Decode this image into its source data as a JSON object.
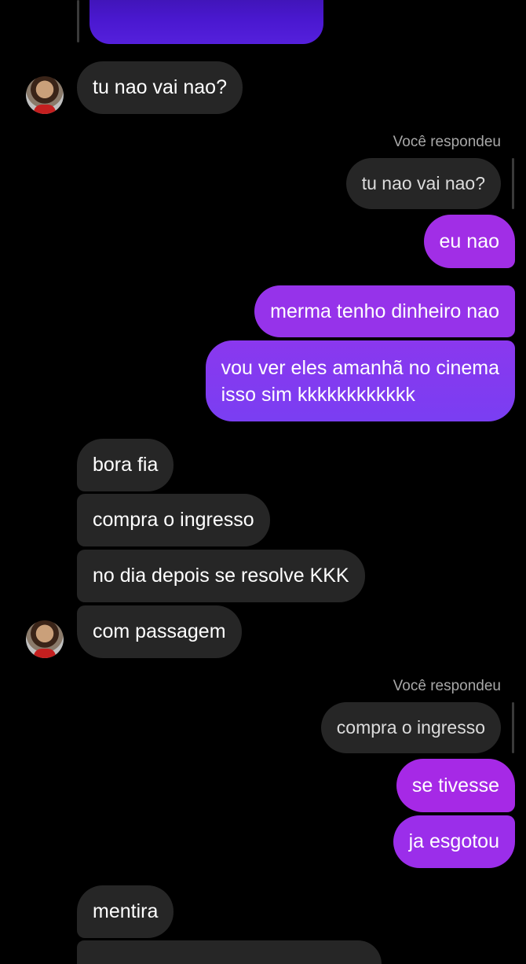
{
  "conversation": {
    "replied_label": "Você respondeu",
    "messages": [
      {
        "text": "tu nao vai nao?"
      },
      {
        "text": "tu nao vai nao?"
      },
      {
        "text": "eu nao"
      },
      {
        "text": "merma tenho dinheiro nao"
      },
      {
        "line1": "vou ver eles amanhã no cinema",
        "line2": "isso sim kkkkkkkkkkkk"
      },
      {
        "text": "bora fia"
      },
      {
        "text": "compra o ingresso"
      },
      {
        "text": "no dia depois se resolve KKK"
      },
      {
        "text": "com passagem"
      },
      {
        "text": "compra o ingresso"
      },
      {
        "text": "se tivesse"
      },
      {
        "text": "ja esgotou"
      },
      {
        "text": "mentira"
      }
    ]
  },
  "colors": {
    "background": "#000000",
    "incoming_bubble": "#262626",
    "outgoing_gradient_top": "#a22ee6",
    "outgoing_gradient_bottom": "#7c3cf0",
    "secondary_text": "#a8a8a8"
  }
}
